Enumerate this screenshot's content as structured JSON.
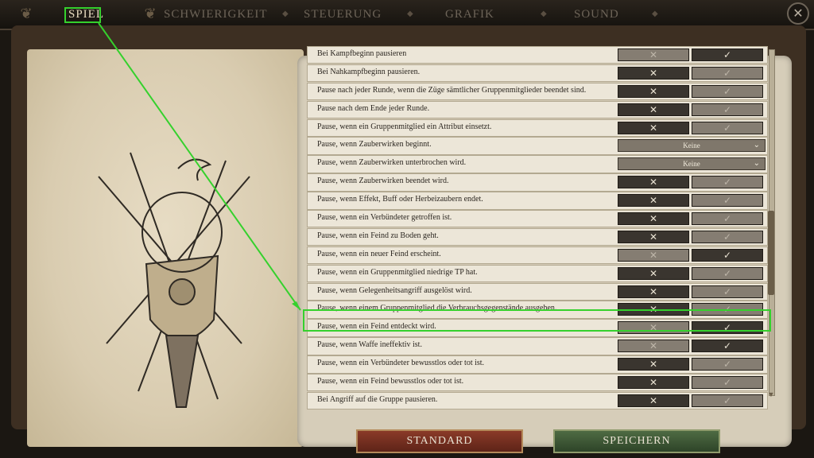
{
  "tabs": [
    {
      "label": "SPIEL"
    },
    {
      "label": "SCHWIERIGKEIT"
    },
    {
      "label": "STEUERUNG"
    },
    {
      "label": "GRAFIK"
    },
    {
      "label": "SOUND"
    }
  ],
  "close_glyph": "✕",
  "icons": {
    "x": "✕",
    "check": "✓",
    "chevron": "⌄",
    "emblem": "crossed-swords-shield-emblem"
  },
  "rows": [
    {
      "label": "Bei Kampfbeginn pausieren",
      "type": "toggle",
      "value": true
    },
    {
      "label": "Bei Nahkampfbeginn pausieren.",
      "type": "toggle",
      "value": false
    },
    {
      "label": "Pause nach jeder Runde, wenn die Züge sämtlicher Gruppenmitglieder beendet sind.",
      "type": "toggle",
      "value": false
    },
    {
      "label": "Pause nach dem Ende jeder Runde.",
      "type": "toggle",
      "value": false
    },
    {
      "label": "Pause, wenn ein Gruppenmitglied ein Attribut einsetzt.",
      "type": "toggle",
      "value": false
    },
    {
      "label": "Pause, wenn Zauberwirken beginnt.",
      "type": "dropdown",
      "value": "Keine"
    },
    {
      "label": "Pause, wenn Zauberwirken unterbrochen wird.",
      "type": "dropdown",
      "value": "Keine"
    },
    {
      "label": "Pause, wenn Zauberwirken beendet wird.",
      "type": "toggle",
      "value": false
    },
    {
      "label": "Pause, wenn Effekt, Buff oder Herbeizaubern endet.",
      "type": "toggle",
      "value": false
    },
    {
      "label": "Pause, wenn ein Verbündeter getroffen ist.",
      "type": "toggle",
      "value": false
    },
    {
      "label": "Pause, wenn ein Feind zu Boden geht.",
      "type": "toggle",
      "value": false
    },
    {
      "label": "Pause, wenn ein neuer Feind erscheint.",
      "type": "toggle",
      "value": true
    },
    {
      "label": "Pause, wenn ein Gruppenmitglied niedrige TP hat.",
      "type": "toggle",
      "value": false
    },
    {
      "label": "Pause, wenn Gelegenheitsangriff ausgelöst wird.",
      "type": "toggle",
      "value": false
    },
    {
      "label": "Pause, wenn einem Gruppenmitglied die Verbrauchsgegenstände ausgehen.",
      "type": "toggle",
      "value": false
    },
    {
      "label": "Pause, wenn ein Feind entdeckt wird.",
      "type": "toggle",
      "value": true
    },
    {
      "label": "Pause, wenn Waffe ineffektiv ist.",
      "type": "toggle",
      "value": true
    },
    {
      "label": "Pause, wenn ein Verbündeter bewusstlos oder tot ist.",
      "type": "toggle",
      "value": false
    },
    {
      "label": "Pause, wenn ein Feind bewusstlos oder tot ist.",
      "type": "toggle",
      "value": false
    },
    {
      "label": "Bei Angriff auf die Gruppe pausieren.",
      "type": "toggle",
      "value": false
    }
  ],
  "scrollbar_position": 0.62,
  "footer": {
    "standard": "STANDARD",
    "save": "SPEICHERN"
  },
  "colors": {
    "highlight": "#35d12d",
    "standard_btn": "#7a3322",
    "save_btn": "#3f5a37"
  }
}
